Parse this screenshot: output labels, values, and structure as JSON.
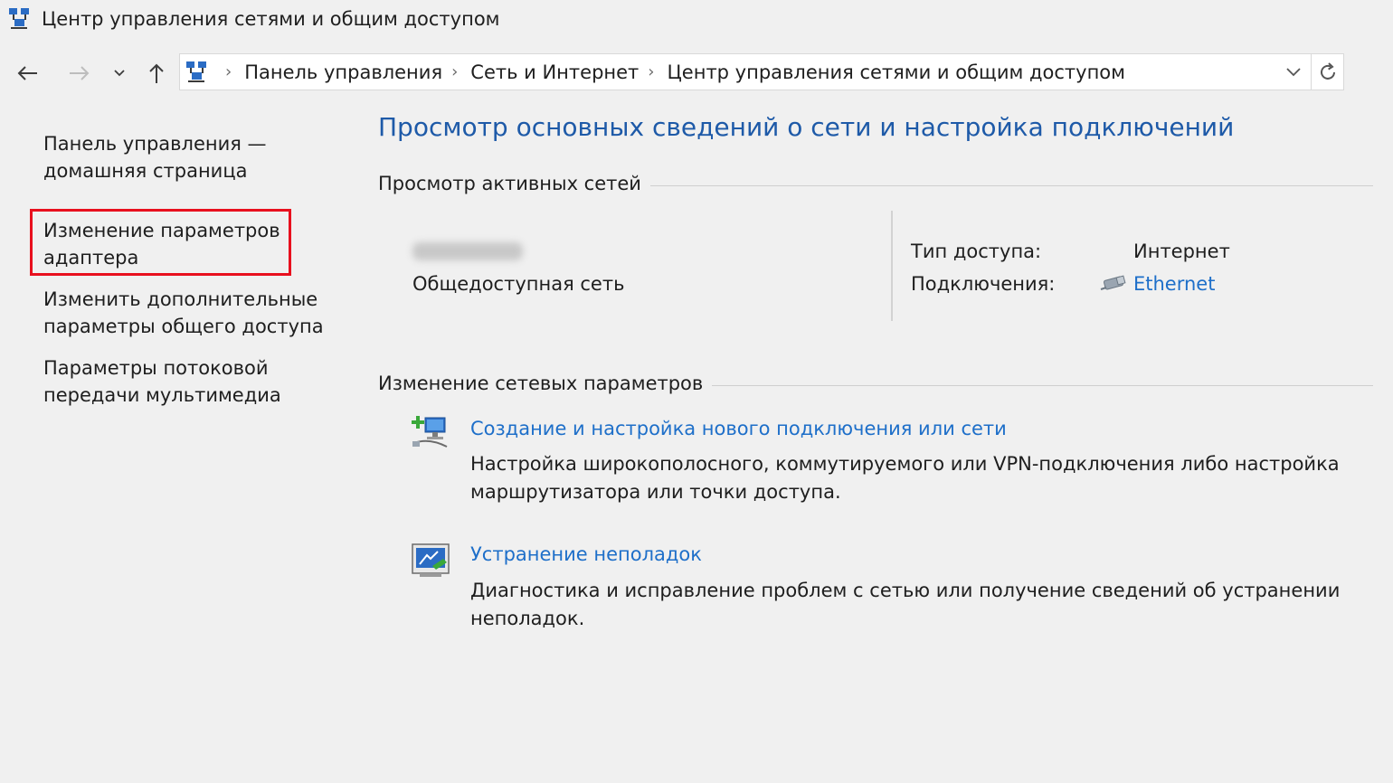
{
  "window": {
    "title": "Центр управления сетями и общим доступом"
  },
  "navigation": {
    "back_icon": "arrow-left-icon",
    "forward_icon": "arrow-right-icon",
    "recent_icon": "chevron-down-icon",
    "up_icon": "arrow-up-icon",
    "refresh_icon": "refresh-icon"
  },
  "breadcrumb": {
    "items": [
      "Панель управления",
      "Сеть и Интернет",
      "Центр управления сетями и общим доступом"
    ],
    "separator": "›"
  },
  "sidebar": {
    "items": [
      {
        "line1": "Панель управления —",
        "line2": "домашняя страница"
      },
      {
        "line1": "Изменение параметров",
        "line2": "адаптера",
        "highlighted": true
      },
      {
        "line1": "Изменить дополнительные",
        "line2": "параметры общего доступа"
      },
      {
        "line1": "Параметры потоковой",
        "line2": "передачи мультимедиа"
      }
    ],
    "highlight_color": "#e8101e"
  },
  "main": {
    "heading": "Просмотр основных сведений о сети и настройка подключений",
    "active_networks": {
      "section_title": "Просмотр активных сетей",
      "network_type": "Общедоступная сеть",
      "access_type_label": "Тип доступа:",
      "access_type_value": "Интернет",
      "connections_label": "Подключения:",
      "connection_value": "Ethernet"
    },
    "change_settings": {
      "section_title": "Изменение сетевых параметров",
      "tasks": [
        {
          "title": "Создание и настройка нового подключения или сети",
          "desc_line1": "Настройка широкополосного, коммутируемого или VPN-подключения либо настройка",
          "desc_line2": "маршрутизатора или точки доступа.",
          "icon": "new-connection-icon"
        },
        {
          "title": "Устранение неполадок",
          "desc_line1": "Диагностика и исправление проблем с сетью или получение сведений об устранении",
          "desc_line2": "неполадок.",
          "icon": "troubleshoot-icon"
        }
      ]
    }
  },
  "colors": {
    "link": "#1e6fc9",
    "heading": "#1e5aa8",
    "background": "#f0f0f0"
  }
}
